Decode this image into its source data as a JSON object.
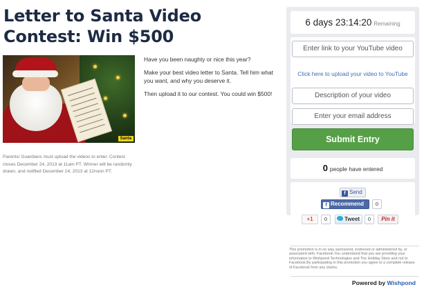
{
  "title": "Letter to Santa Video Contest: Win $500",
  "image": {
    "tag": "Santa"
  },
  "description": [
    "Have you been naughty or nice this year?",
    "Make your best video letter to Santa. Tell him what you want, and why you deserve it.",
    "Then upload it to our contest. You could win $500!"
  ],
  "rules_text": "Parents/ Guardians must upload the videos to enter. Contest closes December 24, 2013 at 11am PT. Winner will be randomly drawn, and notified December 24, 2013 at 12noon PT.",
  "timer": {
    "value": "6 days 23:14:20",
    "label": "Remaining"
  },
  "form": {
    "youtube_placeholder": "Enter link to your YouTube video",
    "upload_link": "Click here to upload your video to YouTube",
    "description_placeholder": "Description of your video",
    "email_placeholder": "Enter your email address",
    "submit_label": "Submit Entry"
  },
  "entries": {
    "count": "0",
    "label": "people have entered"
  },
  "share": {
    "send_label": "Send",
    "recommend_label": "Recommend",
    "recommend_count": "0",
    "gplus_label": "+1",
    "gplus_count": "0",
    "tweet_label": "Tweet",
    "tweet_count": "0",
    "pin_label": "Pin it"
  },
  "disclaimer": "This promotion is in no way sponsored, endorsed or administered by, or associated with, Facebook.You understand that you are providing your information to Wishpond Technologies and The Holiday Store and not to Facebook.By participating in this promotion you agree to a complete release of Facebook from any claims.",
  "powered": {
    "prefix": "Powered by",
    "brand": "Wishpond"
  },
  "colors": {
    "submit": "#55a046",
    "link": "#3b6fb7",
    "facebook": "#3b5998",
    "title": "#1d2a44"
  }
}
